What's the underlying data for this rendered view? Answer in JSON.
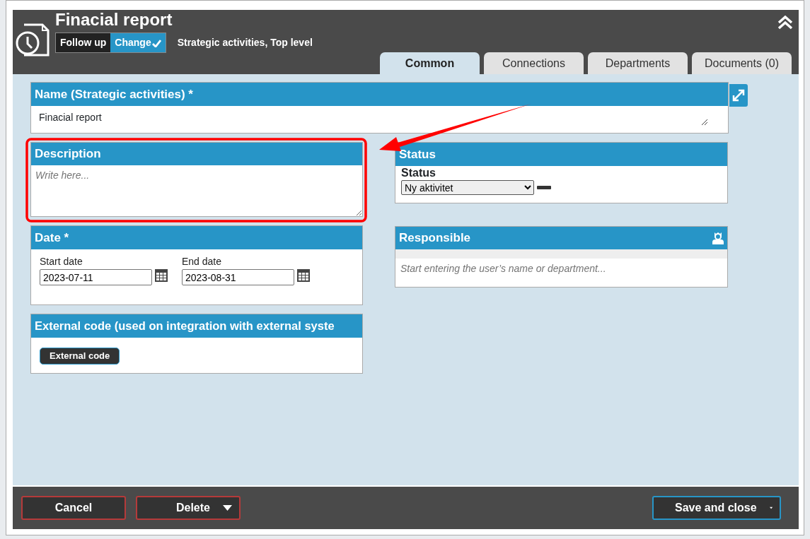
{
  "window": {
    "title": "Finacial report",
    "breadcrumb": "Strategic activities, Top level"
  },
  "mode_toggle": [
    {
      "label": "Follow up",
      "selected": false
    },
    {
      "label": "Change",
      "selected": true
    }
  ],
  "tabs": [
    {
      "label": "Common",
      "selected": true
    },
    {
      "label": "Connections",
      "selected": false
    },
    {
      "label": "Departments",
      "selected": false
    },
    {
      "label": "Documents (0)",
      "selected": false
    }
  ],
  "name_panel": {
    "title": "Name (Strategic activities) *",
    "value": "Finacial report"
  },
  "description_panel": {
    "title": "Description",
    "placeholder": "Write here..."
  },
  "date_panel": {
    "title": "Date *",
    "fields": [
      {
        "label": "Start date",
        "value": "2023-07-11"
      },
      {
        "label": "End date",
        "value": "2023-08-31"
      }
    ]
  },
  "external_code_panel": {
    "title": "External code (used on integration with external syste",
    "button": "External code"
  },
  "status_panel": {
    "title": "Status",
    "label": "Status",
    "value": "Ny aktivitet"
  },
  "responsible_panel": {
    "title": "Responsible",
    "placeholder": "Start entering the user’s name or department..."
  },
  "footer": {
    "buttons": [
      {
        "label": "Cancel",
        "kind": "plain",
        "primary": false
      },
      {
        "label": "Delete",
        "kind": "dropdown",
        "primary": false
      },
      {
        "label": "Save and close",
        "kind": "dropdown",
        "primary": true
      }
    ]
  }
}
